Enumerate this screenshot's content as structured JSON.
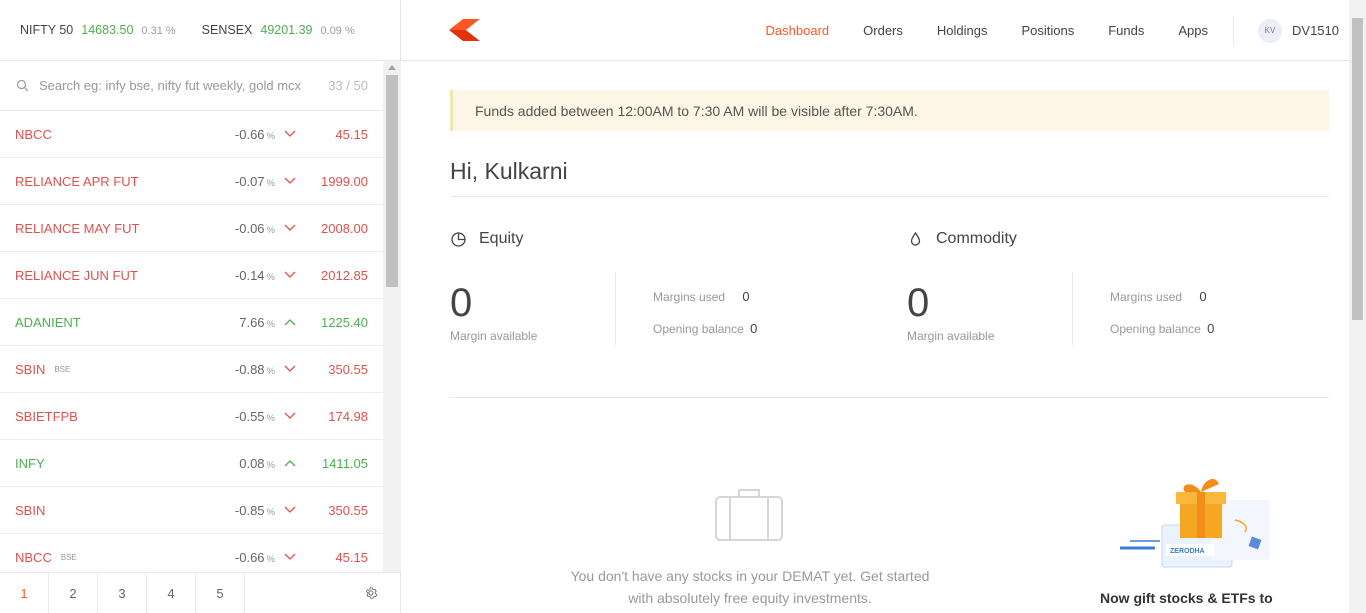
{
  "indices": [
    {
      "name": "NIFTY 50",
      "value": "14683.50",
      "change": "0.31 %"
    },
    {
      "name": "SENSEX",
      "value": "49201.39",
      "change": "0.09 %"
    }
  ],
  "search": {
    "placeholder": "Search eg: infy bse, nifty fut weekly, gold mcx",
    "count": "33 / 50"
  },
  "watchlist": [
    {
      "symbol": "NBCC",
      "exchange": "",
      "change": "-0.66",
      "direction": "down",
      "price": "45.15"
    },
    {
      "symbol": "RELIANCE APR FUT",
      "exchange": "",
      "change": "-0.07",
      "direction": "down",
      "price": "1999.00"
    },
    {
      "symbol": "RELIANCE MAY FUT",
      "exchange": "",
      "change": "-0.06",
      "direction": "down",
      "price": "2008.00"
    },
    {
      "symbol": "RELIANCE JUN FUT",
      "exchange": "",
      "change": "-0.14",
      "direction": "down",
      "price": "2012.85"
    },
    {
      "symbol": "ADANIENT",
      "exchange": "",
      "change": "7.66",
      "direction": "up",
      "price": "1225.40"
    },
    {
      "symbol": "SBIN",
      "exchange": "BSE",
      "change": "-0.88",
      "direction": "down",
      "price": "350.55"
    },
    {
      "symbol": "SBIETFPB",
      "exchange": "",
      "change": "-0.55",
      "direction": "down",
      "price": "174.98"
    },
    {
      "symbol": "INFY",
      "exchange": "",
      "change": "0.08",
      "direction": "up",
      "price": "1411.05"
    },
    {
      "symbol": "SBIN",
      "exchange": "",
      "change": "-0.85",
      "direction": "down",
      "price": "350.55"
    },
    {
      "symbol": "NBCC",
      "exchange": "BSE",
      "change": "-0.66",
      "direction": "down",
      "price": "45.15"
    }
  ],
  "pct_sign": "%",
  "pages": [
    "1",
    "2",
    "3",
    "4",
    "5"
  ],
  "active_page": "1",
  "nav": {
    "items": [
      "Dashboard",
      "Orders",
      "Holdings",
      "Positions",
      "Funds",
      "Apps"
    ],
    "active": "Dashboard",
    "avatar_initials": "KV",
    "user_id": "DV1510"
  },
  "notice": "Funds added between 12:00AM to 7:30 AM will be visible after 7:30AM.",
  "greeting": "Hi, Kulkarni",
  "segments": {
    "equity": {
      "title": "Equity",
      "margin_available": "0",
      "margin_available_label": "Margin available",
      "margins_used_label": "Margins used",
      "margins_used": "0",
      "opening_balance_label": "Opening balance",
      "opening_balance": "0"
    },
    "commodity": {
      "title": "Commodity",
      "margin_available": "0",
      "margin_available_label": "Margin available",
      "margins_used_label": "Margins used",
      "margins_used": "0",
      "opening_balance_label": "Opening balance",
      "opening_balance": "0"
    }
  },
  "empty_state": {
    "line1": "You don't have any stocks in your DEMAT yet. Get started",
    "line2": "with absolutely free equity investments."
  },
  "gift": {
    "text": "Now gift stocks & ETFs to",
    "card_label": "ZERODHA"
  },
  "colors": {
    "accent": "#ff5722",
    "up": "#4caf50",
    "down": "#df514c"
  }
}
